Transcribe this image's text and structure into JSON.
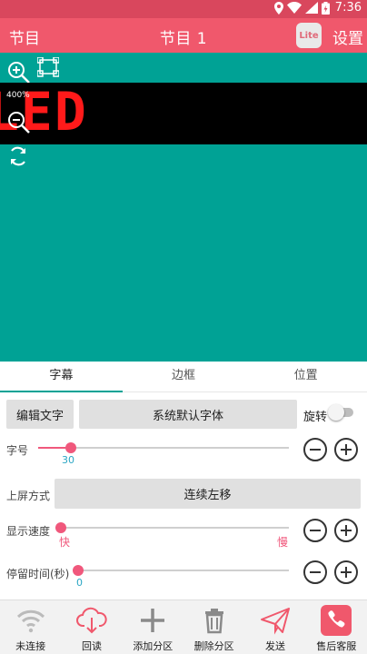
{
  "status_bar": {
    "time": "7:36"
  },
  "app_bar": {
    "left_title": "节目",
    "title": "节目 1",
    "lite_badge": "Lite",
    "settings": "设置"
  },
  "preview": {
    "zoom_level": "400%",
    "led_text": "LED",
    "background_color": "#00a295",
    "led_color": "#ff1a1a"
  },
  "tabs": [
    {
      "label": "字幕",
      "active": true
    },
    {
      "label": "边框",
      "active": false
    },
    {
      "label": "位置",
      "active": false
    }
  ],
  "subtitle": {
    "edit_text_button": "编辑文字",
    "font_button": "系统默认字体",
    "rotate_label": "旋转",
    "rotate_on": false,
    "font_size_label": "字号",
    "font_size_value": "30",
    "font_size_fraction": 0.11,
    "mode_label": "上屏方式",
    "mode_value": "连续左移",
    "speed_label": "显示速度",
    "speed_min_label": "快",
    "speed_max_label": "慢",
    "speed_fraction": 0.0,
    "stay_label": "停留时间(秒)",
    "stay_value": "0",
    "stay_fraction": 0.0
  },
  "bottom_nav": [
    {
      "label": "未连接",
      "icon": "wifi-icon"
    },
    {
      "label": "回读",
      "icon": "cloud-download-icon"
    },
    {
      "label": "添加分区",
      "icon": "plus-icon"
    },
    {
      "label": "删除分区",
      "icon": "trash-icon"
    },
    {
      "label": "发送",
      "icon": "send-icon"
    },
    {
      "label": "售后客服",
      "icon": "phone-icon"
    }
  ],
  "colors": {
    "accent": "#f0586c",
    "teal": "#00a295",
    "slider": "#f0587c",
    "value_text": "#2ba6c4"
  }
}
